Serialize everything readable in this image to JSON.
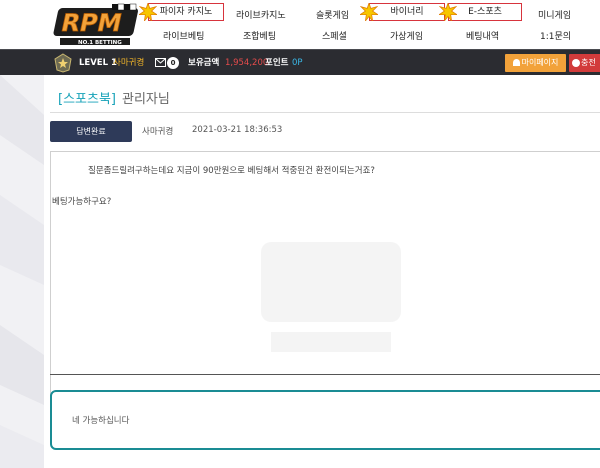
{
  "brand": {
    "name": "RPM",
    "tagline": "NO.1 BETTING",
    "accent": "#f2a23a",
    "hot_border": "#d7343d"
  },
  "nav": {
    "row1": [
      {
        "label": "파이자 카지노",
        "hot": true
      },
      {
        "label": "라이브카지노",
        "hot": false
      },
      {
        "label": "슬롯게임",
        "hot": false
      },
      {
        "label": "바이너리",
        "hot": true
      },
      {
        "label": "E-스포츠",
        "hot": true
      },
      {
        "label": "미니게임",
        "hot": false
      }
    ],
    "row2": [
      {
        "label": "라이브베팅"
      },
      {
        "label": "조합베팅"
      },
      {
        "label": "스페셜"
      },
      {
        "label": "가상게임"
      },
      {
        "label": "베팅내역"
      },
      {
        "label": "1:1문의"
      }
    ]
  },
  "userbar": {
    "level": "LEVEL 1",
    "username": "사마귀켱",
    "message_count": "0",
    "balance_label": "보유금액",
    "balance_value": "1,954,200",
    "points_label": "포인트",
    "points_value": "0P",
    "mypage_label": "마이페이지",
    "charge_label": "충전"
  },
  "post": {
    "category": "[스포츠북]",
    "author_title": "관리자님",
    "status": "답변완료",
    "author": "사마귀켱",
    "datetime": "2021-03-21 18:36:53",
    "body_line1": "질문좀드릴려구하는데요 지금이 90만원으로 베팅해서 적중된건 환전이되는거죠?",
    "body_line2": "베팅가능하구요?"
  },
  "reply": {
    "text": "네 가능하십니다",
    "border_color": "#1a8c94"
  }
}
